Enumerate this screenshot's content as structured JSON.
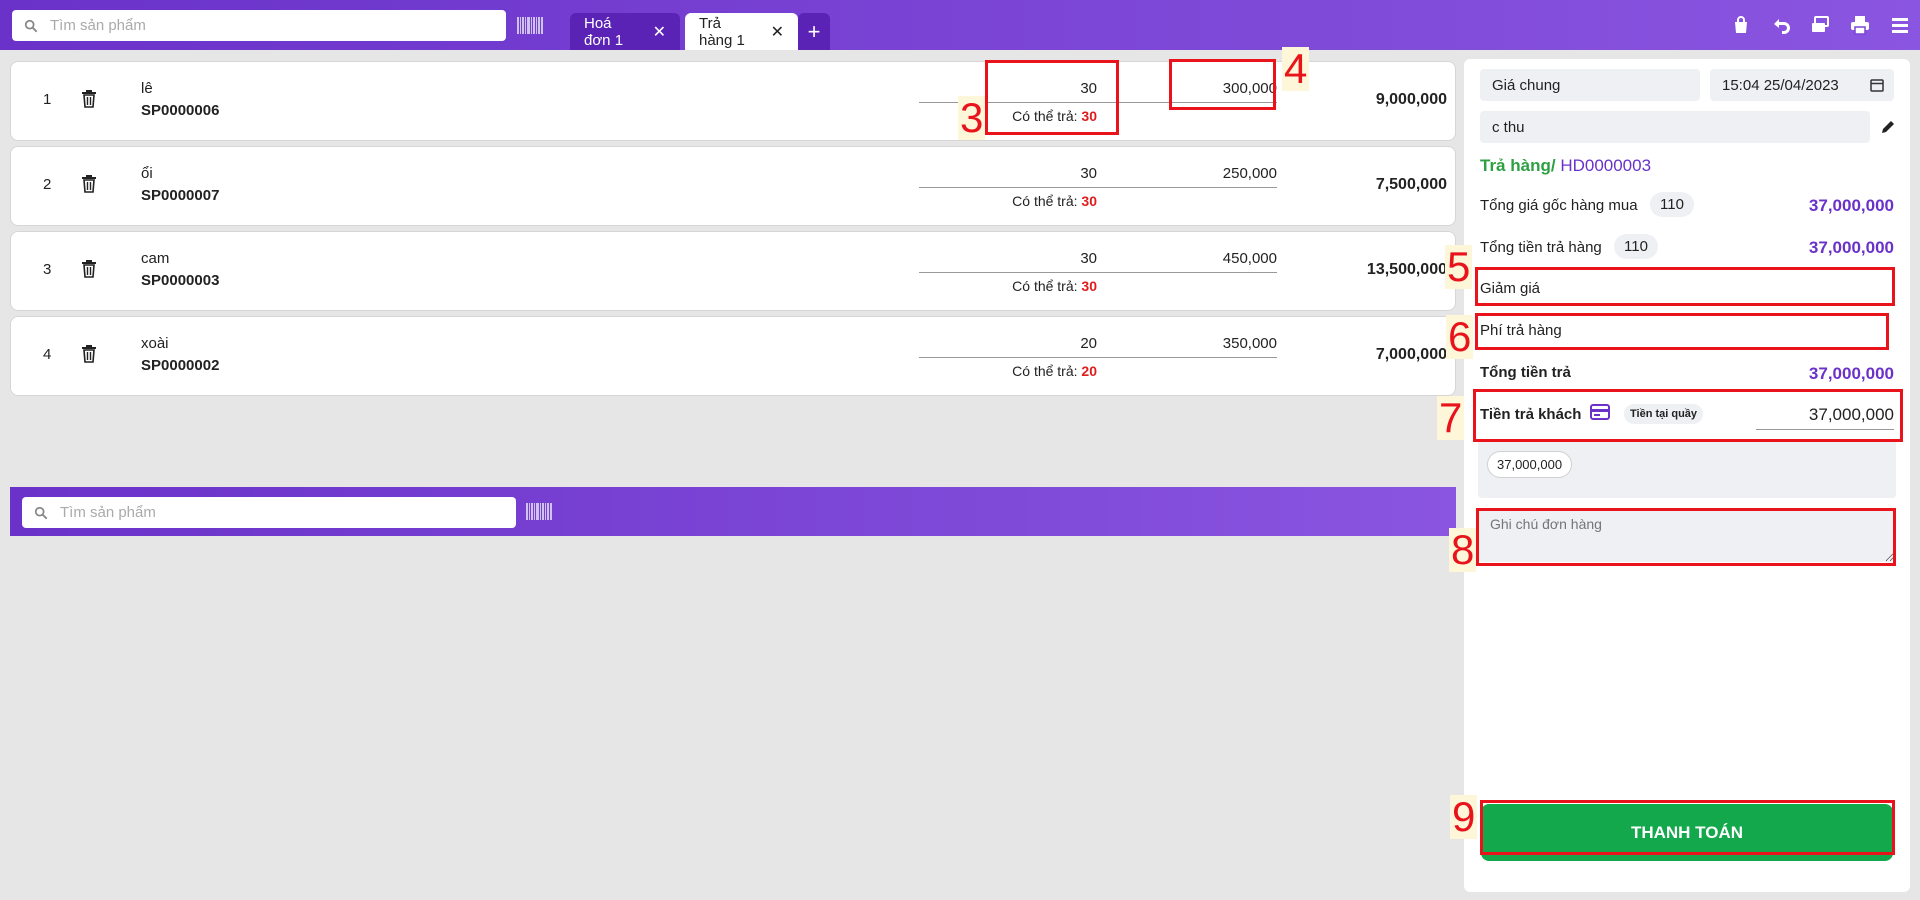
{
  "search": {
    "placeholder": "Tìm sản phẩm"
  },
  "tabs": [
    {
      "label": "Hoá đơn 1",
      "active": false
    },
    {
      "label": "Trả hàng 1",
      "active": true
    }
  ],
  "add_tab_label": "+",
  "top_icons": [
    "shopping-bag-icon",
    "undo-icon",
    "stack-icon",
    "printer-icon",
    "menu-icon"
  ],
  "avail_prefix": "Có thể trả:",
  "items": [
    {
      "index": "1",
      "name": "lê",
      "code": "SP0000006",
      "qty": "30",
      "avail": "30",
      "price": "300,000",
      "total": "9,000,000"
    },
    {
      "index": "2",
      "name": "ổi",
      "code": "SP0000007",
      "qty": "30",
      "avail": "30",
      "price": "250,000",
      "total": "7,500,000"
    },
    {
      "index": "3",
      "name": "cam",
      "code": "SP0000003",
      "qty": "30",
      "avail": "30",
      "price": "450,000",
      "total": "13,500,000"
    },
    {
      "index": "4",
      "name": "xoài",
      "code": "SP0000002",
      "qty": "20",
      "avail": "20",
      "price": "350,000",
      "total": "7,000,000"
    }
  ],
  "bottom_search": {
    "placeholder": "Tìm sản phẩm"
  },
  "panel": {
    "price_list": "Giá chung",
    "datetime": "15:04 25/04/2023",
    "customer": "c thu",
    "return_label": "Trả hàng/",
    "invoice_code": "HD0000003",
    "original_total_label": "Tổng giá gốc hàng mua",
    "original_total_count": "110",
    "original_total_value": "37,000,000",
    "return_total_label": "Tổng tiền trả hàng",
    "return_total_count": "110",
    "return_total_value": "37,000,000",
    "discount_label": "Giảm giá",
    "return_fee_label": "Phí trả hàng",
    "total_refund_label": "Tổng tiền trả",
    "total_refund_value": "37,000,000",
    "pay_customer_label": "Tiền trả khách",
    "payment_method": "Tiền tại quầy",
    "pay_customer_value": "37,000,000",
    "suggest_amount": "37,000,000",
    "note_placeholder": "Ghi chú đơn hàng",
    "pay_button": "THANH TOÁN"
  },
  "annotations": [
    "3",
    "4",
    "5",
    "6",
    "7",
    "8",
    "9"
  ],
  "colors": {
    "brand": "#6a32c9",
    "accent_value": "#6a32c9",
    "green": "#13a84b",
    "red": "#e8131b",
    "return_green": "#2ea043"
  }
}
